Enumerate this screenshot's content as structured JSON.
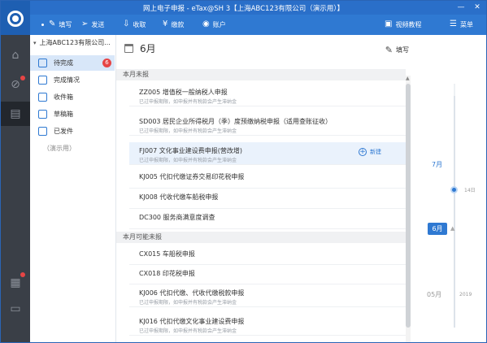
{
  "window": {
    "title": "网上电子申报 - eTax@SH 3【上海ABC123有限公司（演示用）】",
    "buttons": {
      "minimize": "—",
      "close": "✕"
    }
  },
  "toolbar": {
    "write": "填写",
    "send": "发送",
    "receive": "收取",
    "pay": "缴款",
    "account": "账户",
    "video": "视频教程",
    "menu": "菜单"
  },
  "nav": {
    "company": "上海ABC123有限公司...",
    "items": [
      {
        "label": "待完成",
        "count": "6"
      },
      {
        "label": "完成情况"
      },
      {
        "label": "收件箱"
      },
      {
        "label": "草稿箱"
      },
      {
        "label": "已发件"
      }
    ],
    "demo": "（演示用）"
  },
  "main": {
    "month": "6月",
    "fill_label": "填写",
    "sections": [
      {
        "title": "本月未报",
        "rows": [
          {
            "title": "ZZ005 增值税一般纳税人申报",
            "sub": "已过申报期限，如申报并有税款会产生滞纳金"
          },
          {
            "title": "SD003 居民企业所得税月（季）度预缴纳税申报（适用查账征收）",
            "sub": "已过申报期限，如申报并有税款会产生滞纳金"
          },
          {
            "title": "FJ007 文化事业建设费申报(营改增)",
            "sub": "已过申报期限，如申报并有税款会产生滞纳金",
            "action": "新建"
          },
          {
            "title": "KJ005 代扣代缴证券交易印花税申报",
            "sub": ""
          },
          {
            "title": "KJ008 代收代缴车船税申报",
            "sub": ""
          },
          {
            "title": "DC300 服务商满意度调查",
            "sub": ""
          }
        ]
      },
      {
        "title": "本月可能未报",
        "rows": [
          {
            "title": "CX015 车船税申报",
            "sub": ""
          },
          {
            "title": "CX018 印花税申报",
            "sub": ""
          },
          {
            "title": "KJ006 代扣代缴、代收代缴税款申报",
            "sub": "已过申报期限，如申报并有税款会产生滞纳金"
          },
          {
            "title": "KJ016 代扣代缴文化事业建设费申报",
            "sub": "已过申报期限，如申报并有税款会产生滞纳金"
          }
        ]
      }
    ]
  },
  "timeline": {
    "month_next": "7月",
    "day": "14日",
    "current": "6月",
    "month_prev": "05月",
    "year": "2019"
  },
  "colors": {
    "title_bar": "#2a6fc9",
    "toolbar": "#2f79d2",
    "rail": "#3a3f47",
    "accent": "#2f79d2",
    "badge": "#e64545"
  }
}
